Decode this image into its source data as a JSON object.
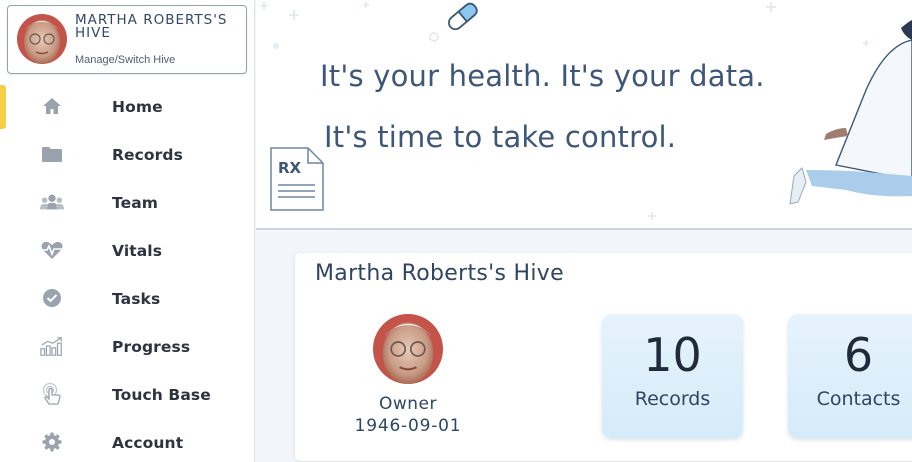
{
  "hive_switcher": {
    "title": "MARTHA ROBERTS'S HIVE",
    "subtitle": "Manage/Switch Hive"
  },
  "nav": {
    "items": [
      {
        "label": "Home",
        "icon": "home-icon",
        "active": true
      },
      {
        "label": "Records",
        "icon": "folder-icon"
      },
      {
        "label": "Team",
        "icon": "team-icon"
      },
      {
        "label": "Vitals",
        "icon": "heart-pulse-icon"
      },
      {
        "label": "Tasks",
        "icon": "check-circle-icon"
      },
      {
        "label": "Progress",
        "icon": "chart-icon"
      },
      {
        "label": "Touch Base",
        "icon": "touch-icon"
      },
      {
        "label": "Account",
        "icon": "gear-icon"
      }
    ]
  },
  "banner": {
    "line1": "It's your health. It's your data.",
    "line2": "It's time to take control.",
    "rx_text": "RX"
  },
  "hive_card": {
    "title": "Martha Roberts's Hive",
    "owner_label": "Owner",
    "owner_dob": "1946-09-01",
    "stats": [
      {
        "value": "10",
        "label": "Records"
      },
      {
        "value": "6",
        "label": "Contacts"
      }
    ]
  },
  "colors": {
    "accent": "#f6cf47",
    "heading": "#3e5678",
    "stat_bg": "#dcedfa",
    "nav_icon": "#9aa3ad"
  }
}
